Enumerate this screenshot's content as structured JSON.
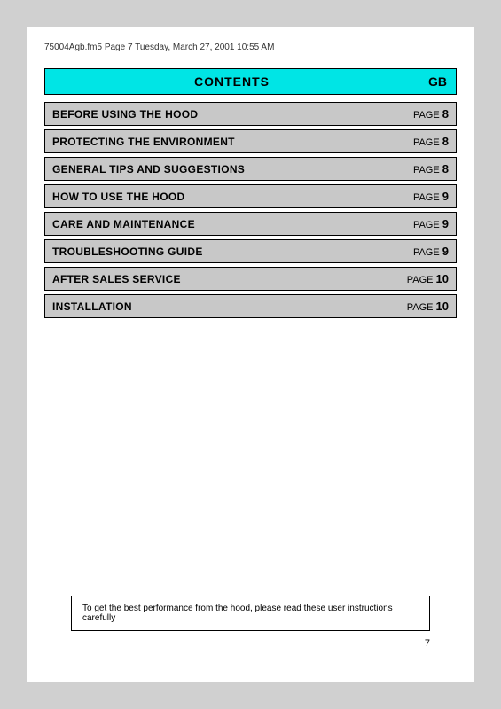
{
  "header": {
    "file_info": "75004Agb.fm5  Page 7  Tuesday, March 27, 2001  10:55 AM"
  },
  "contents": {
    "title": "CONTENTS",
    "gb_label": "GB"
  },
  "toc_items": [
    {
      "label": "BEFORE USING THE HOOD",
      "page_text": "PAGE",
      "page_num": "8"
    },
    {
      "label": "PROTECTING THE ENVIRONMENT",
      "page_text": "PAGE",
      "page_num": "8"
    },
    {
      "label": "GENERAL TIPS AND SUGGESTIONS",
      "page_text": "PAGE",
      "page_num": "8"
    },
    {
      "label": "HOW TO USE THE HOOD",
      "page_text": "PAGE",
      "page_num": "9"
    },
    {
      "label": "CARE AND MAINTENANCE",
      "page_text": "PAGE",
      "page_num": "9"
    },
    {
      "label": "TROUBLESHOOTING GUIDE",
      "page_text": "PAGE",
      "page_num": "9"
    },
    {
      "label": "AFTER SALES SERVICE",
      "page_text": "PAGE",
      "page_num": "10"
    },
    {
      "label": "INSTALLATION",
      "page_text": "PAGE",
      "page_num": "10"
    }
  ],
  "footer": {
    "note": "To get the best performance from the hood, please read these user instructions carefully"
  },
  "page_number": "7"
}
